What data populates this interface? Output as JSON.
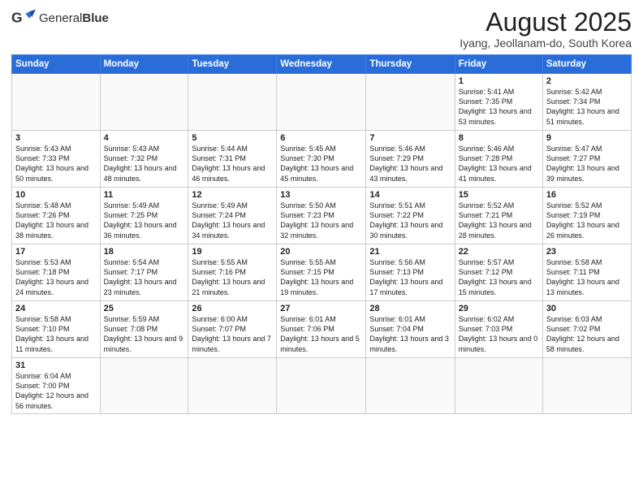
{
  "header": {
    "logo_text_normal": "General",
    "logo_text_bold": "Blue",
    "main_title": "August 2025",
    "subtitle": "Iyang, Jeollanam-do, South Korea"
  },
  "days_of_week": [
    "Sunday",
    "Monday",
    "Tuesday",
    "Wednesday",
    "Thursday",
    "Friday",
    "Saturday"
  ],
  "weeks": [
    [
      {
        "day": "",
        "info": ""
      },
      {
        "day": "",
        "info": ""
      },
      {
        "day": "",
        "info": ""
      },
      {
        "day": "",
        "info": ""
      },
      {
        "day": "",
        "info": ""
      },
      {
        "day": "1",
        "info": "Sunrise: 5:41 AM\nSunset: 7:35 PM\nDaylight: 13 hours\nand 53 minutes."
      },
      {
        "day": "2",
        "info": "Sunrise: 5:42 AM\nSunset: 7:34 PM\nDaylight: 13 hours\nand 51 minutes."
      }
    ],
    [
      {
        "day": "3",
        "info": "Sunrise: 5:43 AM\nSunset: 7:33 PM\nDaylight: 13 hours\nand 50 minutes."
      },
      {
        "day": "4",
        "info": "Sunrise: 5:43 AM\nSunset: 7:32 PM\nDaylight: 13 hours\nand 48 minutes."
      },
      {
        "day": "5",
        "info": "Sunrise: 5:44 AM\nSunset: 7:31 PM\nDaylight: 13 hours\nand 46 minutes."
      },
      {
        "day": "6",
        "info": "Sunrise: 5:45 AM\nSunset: 7:30 PM\nDaylight: 13 hours\nand 45 minutes."
      },
      {
        "day": "7",
        "info": "Sunrise: 5:46 AM\nSunset: 7:29 PM\nDaylight: 13 hours\nand 43 minutes."
      },
      {
        "day": "8",
        "info": "Sunrise: 5:46 AM\nSunset: 7:28 PM\nDaylight: 13 hours\nand 41 minutes."
      },
      {
        "day": "9",
        "info": "Sunrise: 5:47 AM\nSunset: 7:27 PM\nDaylight: 13 hours\nand 39 minutes."
      }
    ],
    [
      {
        "day": "10",
        "info": "Sunrise: 5:48 AM\nSunset: 7:26 PM\nDaylight: 13 hours\nand 38 minutes."
      },
      {
        "day": "11",
        "info": "Sunrise: 5:49 AM\nSunset: 7:25 PM\nDaylight: 13 hours\nand 36 minutes."
      },
      {
        "day": "12",
        "info": "Sunrise: 5:49 AM\nSunset: 7:24 PM\nDaylight: 13 hours\nand 34 minutes."
      },
      {
        "day": "13",
        "info": "Sunrise: 5:50 AM\nSunset: 7:23 PM\nDaylight: 13 hours\nand 32 minutes."
      },
      {
        "day": "14",
        "info": "Sunrise: 5:51 AM\nSunset: 7:22 PM\nDaylight: 13 hours\nand 30 minutes."
      },
      {
        "day": "15",
        "info": "Sunrise: 5:52 AM\nSunset: 7:21 PM\nDaylight: 13 hours\nand 28 minutes."
      },
      {
        "day": "16",
        "info": "Sunrise: 5:52 AM\nSunset: 7:19 PM\nDaylight: 13 hours\nand 26 minutes."
      }
    ],
    [
      {
        "day": "17",
        "info": "Sunrise: 5:53 AM\nSunset: 7:18 PM\nDaylight: 13 hours\nand 24 minutes."
      },
      {
        "day": "18",
        "info": "Sunrise: 5:54 AM\nSunset: 7:17 PM\nDaylight: 13 hours\nand 23 minutes."
      },
      {
        "day": "19",
        "info": "Sunrise: 5:55 AM\nSunset: 7:16 PM\nDaylight: 13 hours\nand 21 minutes."
      },
      {
        "day": "20",
        "info": "Sunrise: 5:55 AM\nSunset: 7:15 PM\nDaylight: 13 hours\nand 19 minutes."
      },
      {
        "day": "21",
        "info": "Sunrise: 5:56 AM\nSunset: 7:13 PM\nDaylight: 13 hours\nand 17 minutes."
      },
      {
        "day": "22",
        "info": "Sunrise: 5:57 AM\nSunset: 7:12 PM\nDaylight: 13 hours\nand 15 minutes."
      },
      {
        "day": "23",
        "info": "Sunrise: 5:58 AM\nSunset: 7:11 PM\nDaylight: 13 hours\nand 13 minutes."
      }
    ],
    [
      {
        "day": "24",
        "info": "Sunrise: 5:58 AM\nSunset: 7:10 PM\nDaylight: 13 hours\nand 11 minutes."
      },
      {
        "day": "25",
        "info": "Sunrise: 5:59 AM\nSunset: 7:08 PM\nDaylight: 13 hours\nand 9 minutes."
      },
      {
        "day": "26",
        "info": "Sunrise: 6:00 AM\nSunset: 7:07 PM\nDaylight: 13 hours\nand 7 minutes."
      },
      {
        "day": "27",
        "info": "Sunrise: 6:01 AM\nSunset: 7:06 PM\nDaylight: 13 hours\nand 5 minutes."
      },
      {
        "day": "28",
        "info": "Sunrise: 6:01 AM\nSunset: 7:04 PM\nDaylight: 13 hours\nand 3 minutes."
      },
      {
        "day": "29",
        "info": "Sunrise: 6:02 AM\nSunset: 7:03 PM\nDaylight: 13 hours\nand 0 minutes."
      },
      {
        "day": "30",
        "info": "Sunrise: 6:03 AM\nSunset: 7:02 PM\nDaylight: 12 hours\nand 58 minutes."
      }
    ],
    [
      {
        "day": "31",
        "info": "Sunrise: 6:04 AM\nSunset: 7:00 PM\nDaylight: 12 hours\nand 56 minutes."
      },
      {
        "day": "",
        "info": ""
      },
      {
        "day": "",
        "info": ""
      },
      {
        "day": "",
        "info": ""
      },
      {
        "day": "",
        "info": ""
      },
      {
        "day": "",
        "info": ""
      },
      {
        "day": "",
        "info": ""
      }
    ]
  ]
}
